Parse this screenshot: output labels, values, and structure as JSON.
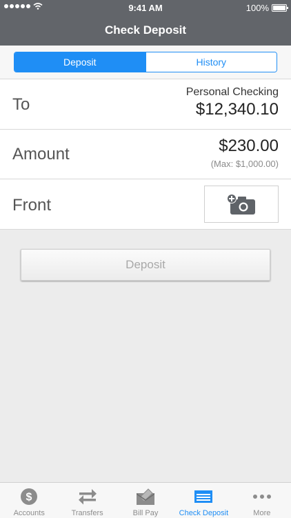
{
  "status": {
    "time": "9:41 AM",
    "battery": "100%"
  },
  "nav": {
    "title": "Check Deposit"
  },
  "segments": {
    "deposit": "Deposit",
    "history": "History"
  },
  "to": {
    "label": "To",
    "account": "Personal Checking",
    "balance": "$12,340.10"
  },
  "amount": {
    "label": "Amount",
    "value": "$230.00",
    "max": "(Max: $1,000.00)"
  },
  "front": {
    "label": "Front"
  },
  "deposit_button": "Deposit",
  "tabs": [
    {
      "label": "Accounts",
      "icon": "dollar-icon"
    },
    {
      "label": "Transfers",
      "icon": "transfer-icon"
    },
    {
      "label": "Bill Pay",
      "icon": "bill-pay-icon"
    },
    {
      "label": "Check Deposit",
      "icon": "check-deposit-icon",
      "active": true
    },
    {
      "label": "More",
      "icon": "more-icon"
    }
  ],
  "colors": {
    "accent": "#1f8ef5",
    "header": "#62656a",
    "background": "#ececec"
  }
}
